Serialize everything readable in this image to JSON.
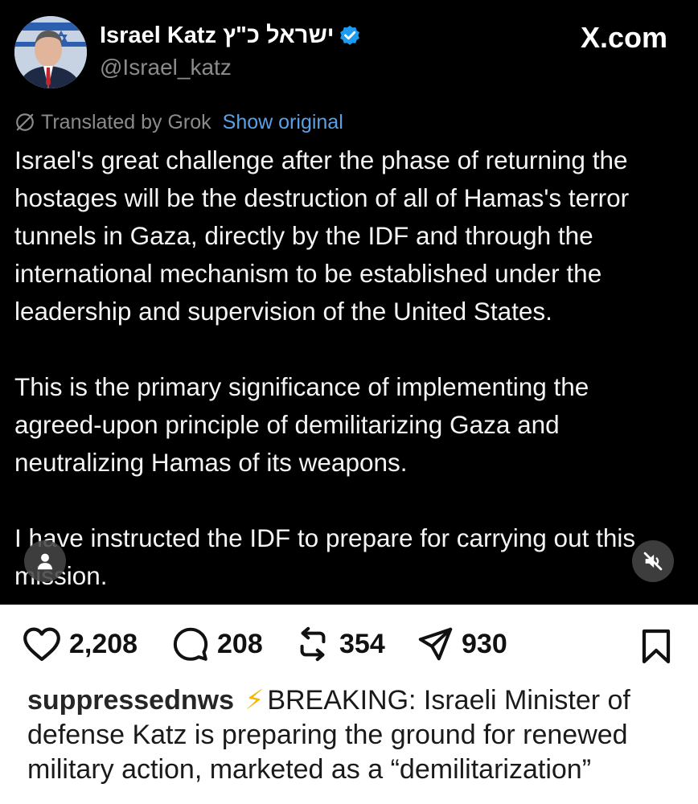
{
  "post": {
    "author_name": "Israel Katz",
    "author_name_hebrew": "ישראל כ\"ץ",
    "author_handle": "@Israel_katz",
    "verified_icon": "verified-badge-icon",
    "site_label": "X.com",
    "translation_label": "Translated by Grok",
    "show_original_label": "Show original",
    "paragraphs": [
      "Israel's great challenge after the phase of returning the hostages will be the destruction of all of Hamas's terror tunnels in Gaza, directly by the IDF and through the international mechanism to be established under the leadership and supervision of the United States.",
      "This is the primary significance of implementing the agreed-upon principle of demilitarizing Gaza and neutralizing Hamas of its weapons.",
      "I have instructed the IDF to prepare for carrying out this mission."
    ]
  },
  "actions": {
    "likes": "2,208",
    "comments": "208",
    "reposts": "354",
    "shares": "930"
  },
  "caption": {
    "username": "suppressednws",
    "emoji": "⚡",
    "text": "BREAKING: Israeli Minister of defense Katz is preparing the ground for renewed military action, marketed as a “demilitarization”"
  },
  "colors": {
    "verified_blue": "#1d9bf0",
    "link_blue": "#5aa0e6",
    "media_background": "#000000",
    "muted_text": "#8b8b8b"
  }
}
